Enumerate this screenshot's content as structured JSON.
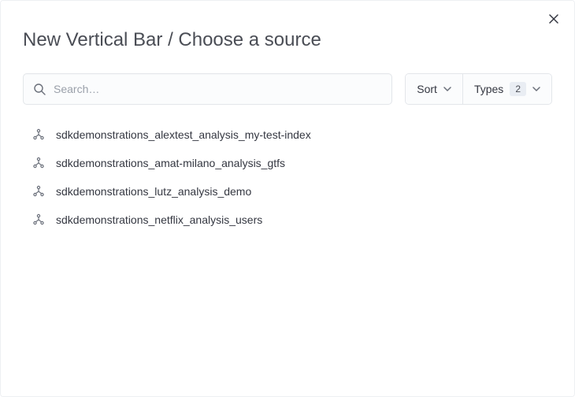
{
  "header": {
    "title": "New Vertical Bar / Choose a source"
  },
  "search": {
    "placeholder": "Search…",
    "value": ""
  },
  "filters": {
    "sort_label": "Sort",
    "types_label": "Types",
    "types_count": "2"
  },
  "sources": [
    {
      "label": "sdkdemonstrations_alextest_analysis_my-test-index"
    },
    {
      "label": "sdkdemonstrations_amat-milano_analysis_gtfs"
    },
    {
      "label": "sdkdemonstrations_lutz_analysis_demo"
    },
    {
      "label": "sdkdemonstrations_netflix_analysis_users"
    }
  ]
}
